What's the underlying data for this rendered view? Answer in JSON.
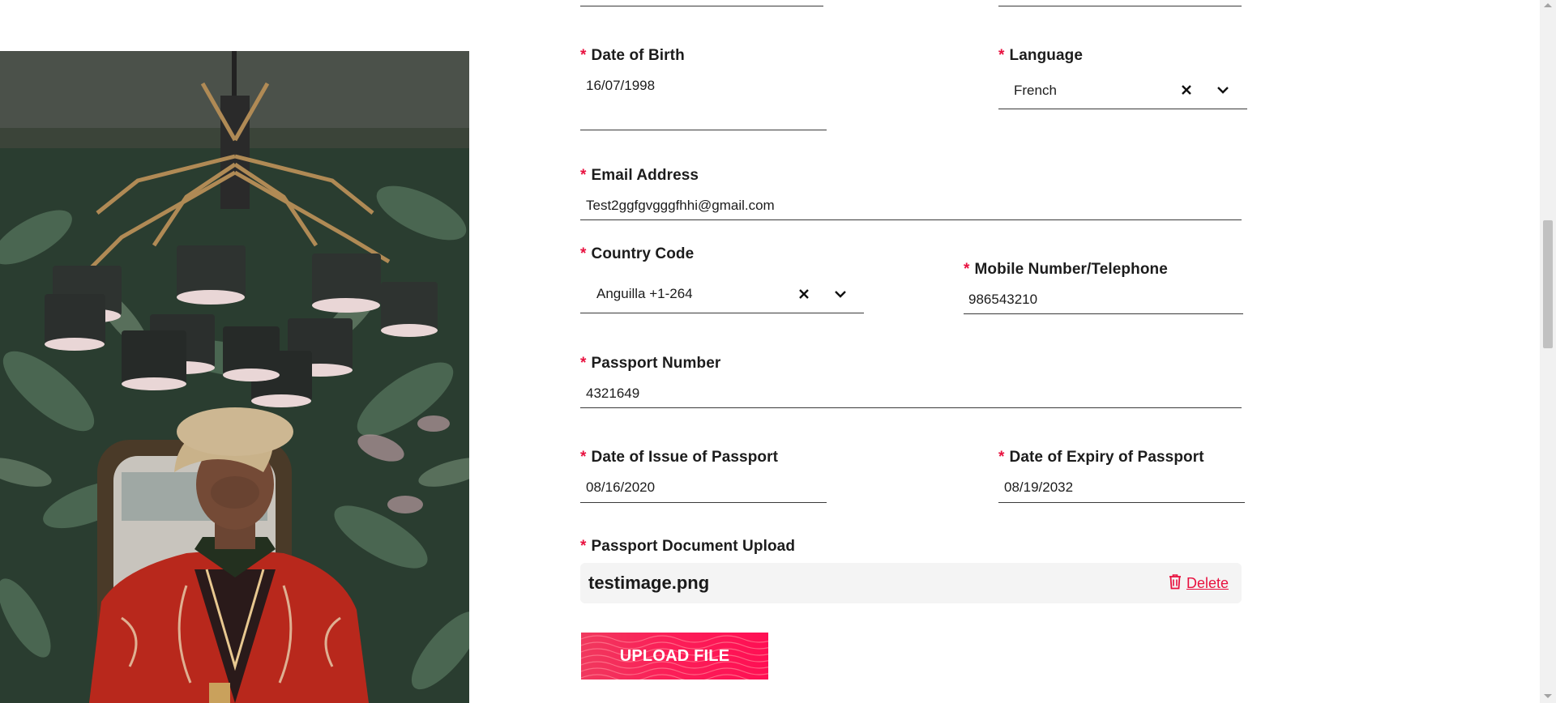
{
  "form": {
    "date_of_birth": {
      "label": "Date of Birth",
      "value": "16/07/1998"
    },
    "language": {
      "label": "Language",
      "value": "French"
    },
    "email": {
      "label": "Email Address",
      "value": "Test2ggfgvgggfhhi@gmail.com"
    },
    "country_code": {
      "label": "Country Code",
      "value": "Anguilla +1-264"
    },
    "mobile": {
      "label": "Mobile Number/Telephone",
      "value": "986543210"
    },
    "passport_number": {
      "label": "Passport Number",
      "value": "4321649"
    },
    "issue_date": {
      "label": "Date of Issue of Passport",
      "value": "08/16/2020"
    },
    "expiry_date": {
      "label": "Date of Expiry of Passport",
      "value": "08/19/2032"
    },
    "passport_upload": {
      "label": "Passport Document Upload",
      "file_name": "testimage.png",
      "delete_label": "Delete"
    },
    "upload_button": "UPLOAD FILE",
    "required_mark": "*"
  },
  "icons": {
    "clear": "close-icon",
    "dropdown": "chevron-down-icon",
    "delete": "trash-icon"
  },
  "colors": {
    "accent": "#e8113f",
    "button": "#ff0f54",
    "upload_box_bg": "#f4f4f4"
  }
}
